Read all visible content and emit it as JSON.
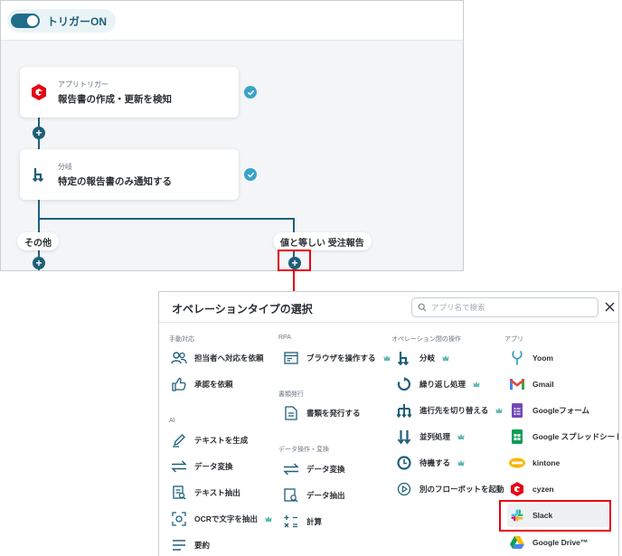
{
  "flow": {
    "trigger_toggle_label": "トリガーON",
    "cards": [
      {
        "sub": "アプリトリガー",
        "title": "報告書の作成・更新を検知"
      },
      {
        "sub": "分岐",
        "title": "特定の報告書のみ通知する"
      }
    ],
    "branches": {
      "other": "その他",
      "match": "値と等しい 受注報告"
    }
  },
  "modal": {
    "title": "オペレーションタイプの選択",
    "search_placeholder": "アプリ名で検索",
    "sections": {
      "manual": {
        "heading": "手動対応",
        "items": [
          {
            "label": "担当者へ対応を依頼",
            "icon": "people-icon"
          },
          {
            "label": "承認を依頼",
            "icon": "thumbs-up-icon"
          }
        ]
      },
      "ai": {
        "heading": "AI",
        "items": [
          {
            "label": "テキストを生成",
            "icon": "pen-icon"
          },
          {
            "label": "データ変換",
            "icon": "convert-icon"
          },
          {
            "label": "テキスト抽出",
            "icon": "extract-icon"
          },
          {
            "label": "OCRで文字を抽出",
            "icon": "ocr-icon",
            "premium": true
          },
          {
            "label": "要約",
            "icon": "summary-icon"
          }
        ]
      },
      "rpa": {
        "heading": "RPA",
        "items": [
          {
            "label": "ブラウザを操作する",
            "icon": "browser-icon",
            "premium": true
          }
        ]
      },
      "document": {
        "heading": "書類発行",
        "items": [
          {
            "label": "書類を発行する",
            "icon": "document-icon"
          }
        ]
      },
      "data_ops": {
        "heading": "データ操作・変換",
        "items": [
          {
            "label": "データ変換",
            "icon": "convert-icon"
          },
          {
            "label": "データ抽出",
            "icon": "data-extract-icon"
          },
          {
            "label": "計算",
            "icon": "calculator-icon"
          }
        ]
      },
      "ops": {
        "heading": "オペレーション間の操作",
        "items": [
          {
            "label": "分岐",
            "icon": "branch-icon",
            "premium": true
          },
          {
            "label": "繰り返し処理",
            "icon": "loop-icon",
            "premium": true
          },
          {
            "label": "進行先を切り替える",
            "icon": "switch-icon",
            "premium": true
          },
          {
            "label": "並列処理",
            "icon": "parallel-icon",
            "premium": true
          },
          {
            "label": "待機する",
            "icon": "clock-icon",
            "premium": true
          },
          {
            "label": "別のフローボットを起動",
            "icon": "play-icon"
          }
        ]
      },
      "apps": {
        "heading": "アプリ",
        "items": [
          {
            "label": "Yoom",
            "icon": "yoom-logo-icon"
          },
          {
            "label": "Gmail",
            "icon": "gmail-logo-icon"
          },
          {
            "label": "Googleフォーム",
            "icon": "google-forms-logo-icon"
          },
          {
            "label": "Google スプレッドシート",
            "icon": "google-sheets-logo-icon"
          },
          {
            "label": "kintone",
            "icon": "kintone-logo-icon"
          },
          {
            "label": "cyzen",
            "icon": "cyzen-logo-icon"
          },
          {
            "label": "Slack",
            "icon": "slack-logo-icon",
            "highlighted": true
          },
          {
            "label": "Google Drive™",
            "icon": "google-drive-logo-icon"
          }
        ]
      }
    }
  },
  "colors": {
    "brand_teal": "#1f5f7a",
    "check_blue": "#3aa3c9",
    "callout_red": "#e60012",
    "premium_teal": "#5fb8b3"
  }
}
